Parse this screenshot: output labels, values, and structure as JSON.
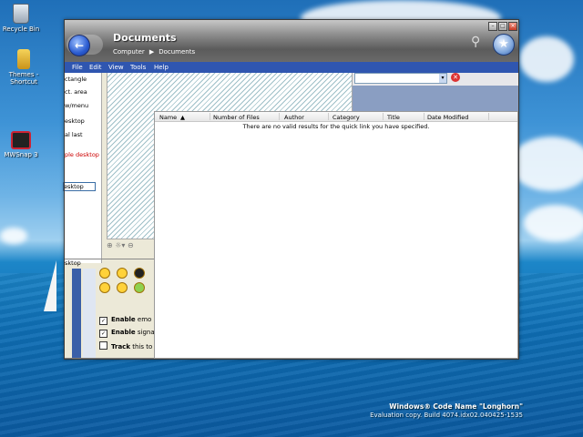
{
  "desktop": {
    "icons": [
      {
        "label": "Recycle Bin"
      },
      {
        "label": "Themes - Shortcut"
      },
      {
        "label": "MWSnap 3"
      }
    ],
    "watermark": {
      "line1": "Windows® Code Name \"Longhorn\"",
      "line2": "Evaluation copy. Build 4074.idx02.040425-1535"
    }
  },
  "window": {
    "title": "Documents",
    "breadcrumb": [
      "Computer",
      "Documents"
    ],
    "menu": [
      "File",
      "Edit",
      "View",
      "Tools",
      "Help"
    ]
  },
  "results": {
    "columns": [
      "Name",
      "Number of Files",
      "Author",
      "Category",
      "Title",
      "Date Modified"
    ],
    "sort_indicator": "▲",
    "empty_message": "There are no valid results for the quick link you have specified."
  },
  "background_app": {
    "list_items": [
      "ctangle",
      "ct. area",
      "w/menu",
      "esktop",
      "al last",
      "ple desktop",
      "esktop"
    ],
    "bottom_label": "sktop",
    "checks": [
      {
        "bold": "Enable",
        "rest": " emo",
        "checked": true
      },
      {
        "bold": "Enable",
        "rest": " signa",
        "checked": true
      },
      {
        "bold": "Track",
        "rest": " this to",
        "checked": false
      }
    ]
  }
}
